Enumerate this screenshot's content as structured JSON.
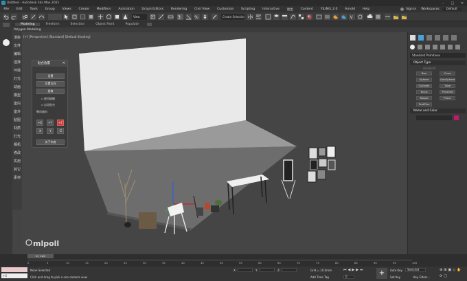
{
  "window": {
    "title": "Untitled - Autodesk 3ds Max 2021"
  },
  "menubar": {
    "items": [
      "File",
      "Edit",
      "Tools",
      "Group",
      "Views",
      "Create",
      "Modifiers",
      "Animation",
      "Graph Editors",
      "Rendering",
      "Civil View",
      "Customize",
      "Scripting",
      "Interactive",
      "退出",
      "Content",
      "YILING_2.0",
      "Arnold",
      "Help"
    ],
    "signin": "Sign In",
    "workspace_label": "Workspaces:",
    "workspace_value": "Default"
  },
  "toolbar": {
    "view_dropdown": "View",
    "selection_set": "Create Selection Se..."
  },
  "ribbon": {
    "tabs": [
      "Modeling",
      "Freeform",
      "Selection",
      "Object Paint",
      "Populate"
    ],
    "active": "Modeling",
    "sub_label": "Polygon Modeling"
  },
  "cn_column": [
    "渲染",
    "文件",
    "编辑",
    "选择",
    "环境",
    "灯光",
    "动画",
    "模型",
    "室内",
    "室外",
    "贴图",
    "材质",
    "灯光",
    "相机",
    "修改",
    "实用",
    "其它",
    "素材"
  ],
  "viewport": {
    "label": "[+] [Perspective] [Standard] [Default Shading]",
    "watermark": "mlpoll"
  },
  "dialog": {
    "title": "贴合放置",
    "buttons": [
      "设置",
      "位置方向",
      "拾取"
    ],
    "checkboxes": [
      "使用碰撞",
      "自动贴合"
    ],
    "axis_label": "朝向轴向",
    "axes_row1": [
      "+X",
      "+Y",
      "+Z"
    ],
    "axes_row2": [
      "-X",
      "-Y",
      "-Z"
    ],
    "bottom_button": "关于作者"
  },
  "right_panel": {
    "dropdown": "Standard Primitives",
    "object_type_label": "Object Type",
    "autogrid": "AutoGrid",
    "objects": [
      "Box",
      "Cone",
      "Sphere",
      "GeoSphere",
      "Cylinder",
      "Tube",
      "Torus",
      "Pyramid",
      "Teapot",
      "Plane",
      "TextPlus"
    ],
    "name_color_label": "Name and Color",
    "swatch_color": "#c0196b"
  },
  "timeline": {
    "slider": "0 / 100",
    "ticks": [
      "0",
      "5",
      "10",
      "15",
      "20",
      "25",
      "30",
      "35",
      "40",
      "45",
      "50",
      "55",
      "60",
      "65",
      "70",
      "75",
      "80",
      "85",
      "90",
      "95",
      "100"
    ]
  },
  "status": {
    "maxscript": "+X",
    "selection": "None Selected",
    "prompt": "Click and drag to pick a non-camera view",
    "x_label": "X:",
    "y_label": "Y:",
    "z_label": "Z:",
    "grid": "Grid = 10.0mm",
    "add_time_tag": "Add Time Tag",
    "frame": "0",
    "autokey": "Auto Key",
    "setkey": "Set Key",
    "key_mode": "Selected",
    "key_filters": "Key Filters..."
  },
  "colors": {
    "accent": "#c0196b",
    "axis_red": "#d81e3c",
    "dialog_active": "#c83a3a"
  }
}
